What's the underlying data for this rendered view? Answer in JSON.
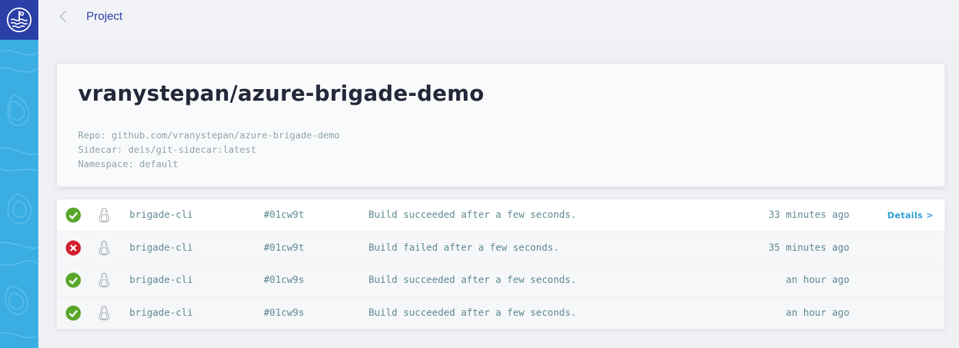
{
  "topbar": {
    "title": "Project"
  },
  "project": {
    "name": "vranystepan/azure-brigade-demo",
    "meta": [
      "Repo: github.com/vranystepan/azure-brigade-demo",
      "Sidecar: deis/git-sidecar:latest",
      "Namespace: default"
    ]
  },
  "builds": [
    {
      "status": "succeeded",
      "status_icon": "check-circle-icon",
      "status_color": "#5aa72b",
      "worker": "brigade-cli",
      "commit": "#01cw9t",
      "message": "Build succeeded after a few seconds.",
      "time": "33 minutes ago",
      "details": "Details >"
    },
    {
      "status": "failed",
      "status_icon": "x-circle-icon",
      "status_color": "#d0202f",
      "worker": "brigade-cli",
      "commit": "#01cw9t",
      "message": "Build failed after a few seconds.",
      "time": "35 minutes ago",
      "details": ""
    },
    {
      "status": "succeeded",
      "status_icon": "check-circle-icon",
      "status_color": "#5aa72b",
      "worker": "brigade-cli",
      "commit": "#01cw9s",
      "message": "Build succeeded after a few seconds.",
      "time": "an hour ago",
      "details": ""
    },
    {
      "status": "succeeded",
      "status_icon": "check-circle-icon",
      "status_color": "#5aa72b",
      "worker": "brigade-cli",
      "commit": "#01cw9s",
      "message": "Build succeeded after a few seconds.",
      "time": "an hour ago",
      "details": ""
    }
  ],
  "colors": {
    "rail": "#3aaee2",
    "logo_bg": "#2b3fa8",
    "title": "#2b3fa8",
    "link": "#2f9fd6"
  }
}
